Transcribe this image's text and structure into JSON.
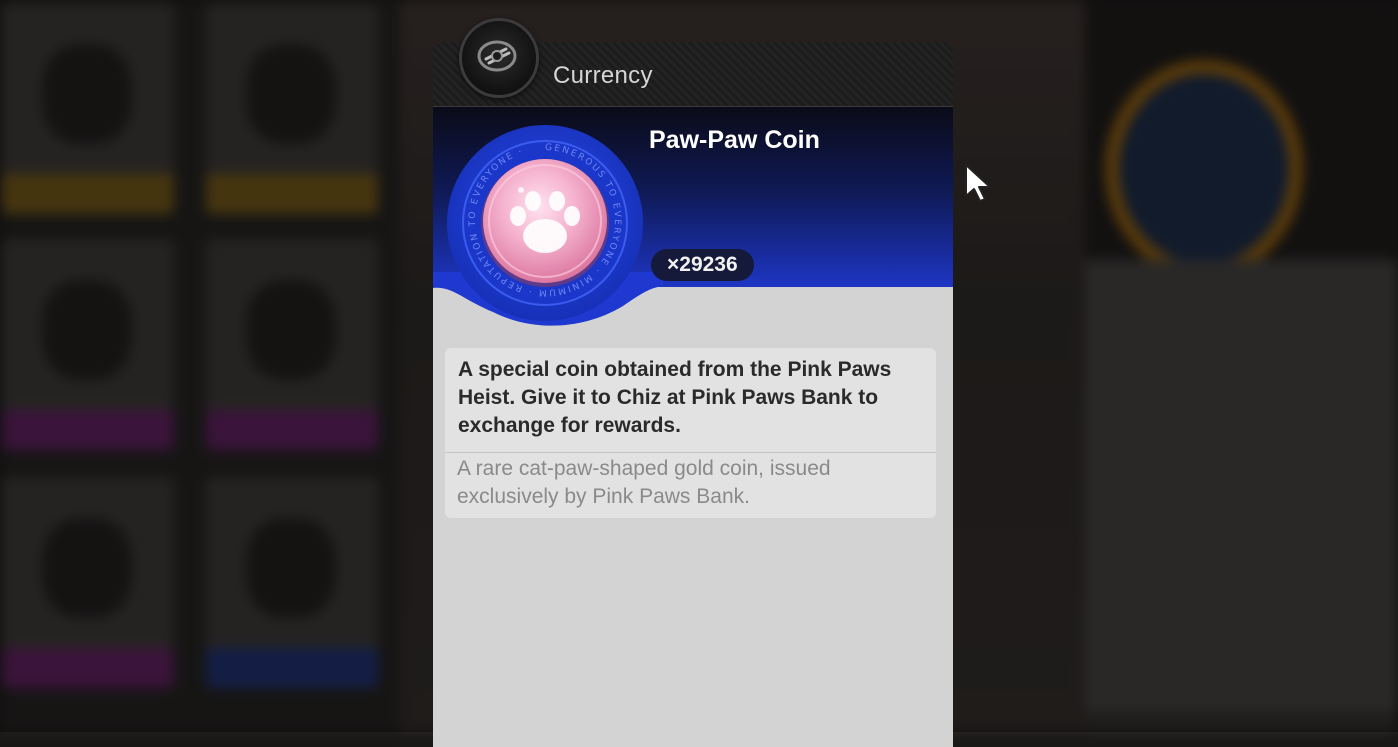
{
  "popup": {
    "category_title": "Currency",
    "category_icon": "currency-token-icon",
    "item": {
      "name": "Paw-Paw Coin",
      "quantity": "×29236",
      "icon": "paw-coin-icon",
      "ring_text": "GENEROUS TO EVERYONE · MINIMUM · REPUTATION TO EVERYONE ·",
      "description": "A special coin obtained from the Pink Paws Heist. Give it to Chiz at Pink Paws Bank to exchange for rewards.",
      "flavor_text": "A rare cat-paw-shaped gold coin, issued exclusively by Pink Paws Bank."
    }
  },
  "colors": {
    "hero_top": "#0b0b18",
    "hero_bottom": "#1f38cf",
    "coin_ring": "#1e3fd8",
    "coin_face": "#f2a6c8",
    "panel_bg": "#d3d3d3"
  },
  "background": {
    "card_band_colors": [
      "#6b5218",
      "#6b5218",
      "#5a1f5a",
      "#5a1f5a",
      "#5a1f5a",
      "#1f2f6b"
    ]
  }
}
